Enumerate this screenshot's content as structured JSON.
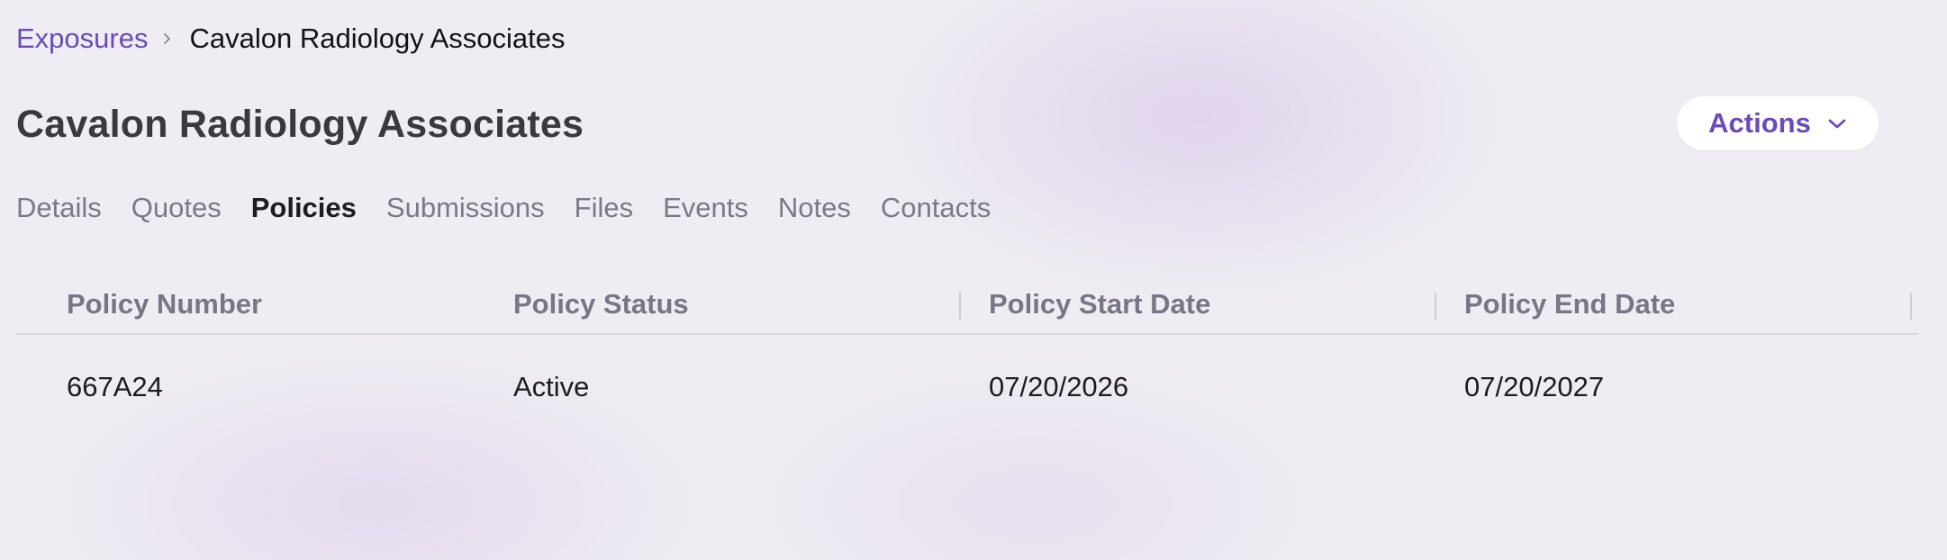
{
  "breadcrumb": {
    "parent": "Exposures",
    "current": "Cavalon Radiology Associates"
  },
  "page": {
    "title": "Cavalon Radiology Associates"
  },
  "actions": {
    "label": "Actions"
  },
  "tabs": [
    {
      "label": "Details",
      "active": false
    },
    {
      "label": "Quotes",
      "active": false
    },
    {
      "label": "Policies",
      "active": true
    },
    {
      "label": "Submissions",
      "active": false
    },
    {
      "label": "Files",
      "active": false
    },
    {
      "label": "Events",
      "active": false
    },
    {
      "label": "Notes",
      "active": false
    },
    {
      "label": "Contacts",
      "active": false
    }
  ],
  "table": {
    "columns": [
      "Policy Number",
      "Policy Status",
      "Policy Start Date",
      "Policy End Date"
    ],
    "rows": [
      [
        "667A24",
        "Active",
        "07/20/2026",
        "07/20/2027"
      ]
    ]
  },
  "colors": {
    "accent": "#6a4bb8",
    "title": "#3b3840",
    "muted": "#7d7886"
  },
  "icons": {
    "breadcrumb_separator": "chevron-right-icon",
    "actions": "chevron-down-icon"
  }
}
